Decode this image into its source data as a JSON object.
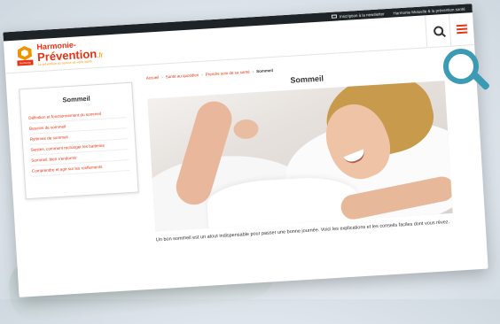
{
  "topbar": {
    "newsletter_label": "Inscription à la newsletter",
    "site_label": "Harmonie Mutuelle & la prévention santé"
  },
  "header": {
    "brand_line1": "Harmonie-",
    "brand_line2": "Prévention",
    "brand_suffix": ".fr",
    "brand_tagline": "La prévention au service de votre santé",
    "logo_tag": "Harmonie",
    "search_icon": "search-icon",
    "menu_icon": "hamburger-menu-icon",
    "accent_color": "#e63312"
  },
  "sidebar": {
    "title": "Sommeil",
    "items": [
      {
        "label": "Définition et fonctionnement du sommeil"
      },
      {
        "label": "Besoins de sommeil"
      },
      {
        "label": "Rythmes de sommeil"
      },
      {
        "label": "Siestes, comment recharger les batteries"
      },
      {
        "label": "Sommeil, bien s'endormir"
      },
      {
        "label": "Comprendre et agir sur les ronflements"
      }
    ]
  },
  "breadcrumb": {
    "items": [
      "Accueil",
      "Santé au quotidien",
      "Prendre soin de sa santé"
    ],
    "current": "Sommeil",
    "separator": "›"
  },
  "main": {
    "title": "Sommeil",
    "intro": "Un bon sommeil est un atout indispensable pour passer une bonne journée. Voici les explications et les conseils faciles dont vous rêvez."
  },
  "overlay": {
    "icon": "magnifier-icon",
    "color": "#3b9bb5"
  }
}
